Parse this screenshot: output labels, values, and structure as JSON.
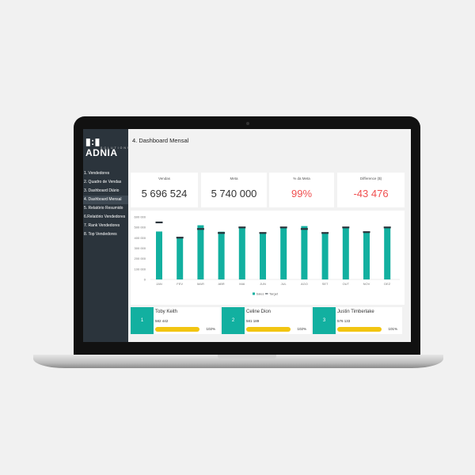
{
  "brand": {
    "logo": "ADNIA",
    "sub": "SOLUTIONS"
  },
  "page_title": "4. Dashboard Mensal",
  "sidebar": {
    "items": [
      {
        "label": "1. Vendedores"
      },
      {
        "label": "2. Quadro de Vendas"
      },
      {
        "label": "3. Dashboard Diário"
      },
      {
        "label": "4. Dashboard Mensal",
        "active": true
      },
      {
        "label": "5. Relatório Resumido"
      },
      {
        "label": "6.Relatório Vendedores"
      },
      {
        "label": "7. Rank Vendedores"
      },
      {
        "label": "8. Top Vendedores"
      }
    ]
  },
  "kpis": [
    {
      "label": "Vendas",
      "value": "5 696 524"
    },
    {
      "label": "Meta",
      "value": "5 740 000"
    },
    {
      "label": "% da Meta",
      "value": "99%"
    },
    {
      "label": "Difference ($)",
      "value": "-43 476"
    }
  ],
  "colors": {
    "accent": "#12b0a0",
    "target": "#2b343c",
    "negative": "#f05050",
    "bar_progress": "#f2c511"
  },
  "chart_data": {
    "type": "bar",
    "categories": [
      "JAN",
      "FEV",
      "MAR",
      "ABR",
      "MAI",
      "JUN",
      "JUL",
      "AGO",
      "SET",
      "OUT",
      "NOV",
      "DEZ"
    ],
    "series": [
      {
        "name": "Sales",
        "values": [
          460000,
          395000,
          520000,
          458000,
          500000,
          448000,
          500000,
          512000,
          445000,
          500000,
          460000,
          500000
        ]
      },
      {
        "name": "Target",
        "values": [
          548000,
          402000,
          485000,
          447000,
          500000,
          447000,
          500000,
          485000,
          447000,
          500000,
          455000,
          500000
        ]
      }
    ],
    "yticks": [
      "0",
      "100 000",
      "200 000",
      "300 000",
      "400 000",
      "500 000",
      "600 000"
    ],
    "ylim": [
      0,
      600000
    ],
    "legend": "bottom",
    "grid": false
  },
  "top": [
    {
      "rank": "1",
      "name": "Toby Keith",
      "value": "582 442",
      "pct": "102%"
    },
    {
      "rank": "2",
      "name": "Celine Dion",
      "value": "581 189",
      "pct": "102%"
    },
    {
      "rank": "3",
      "name": "Justin Timberlake",
      "value": "576 133",
      "pct": "101%"
    }
  ]
}
